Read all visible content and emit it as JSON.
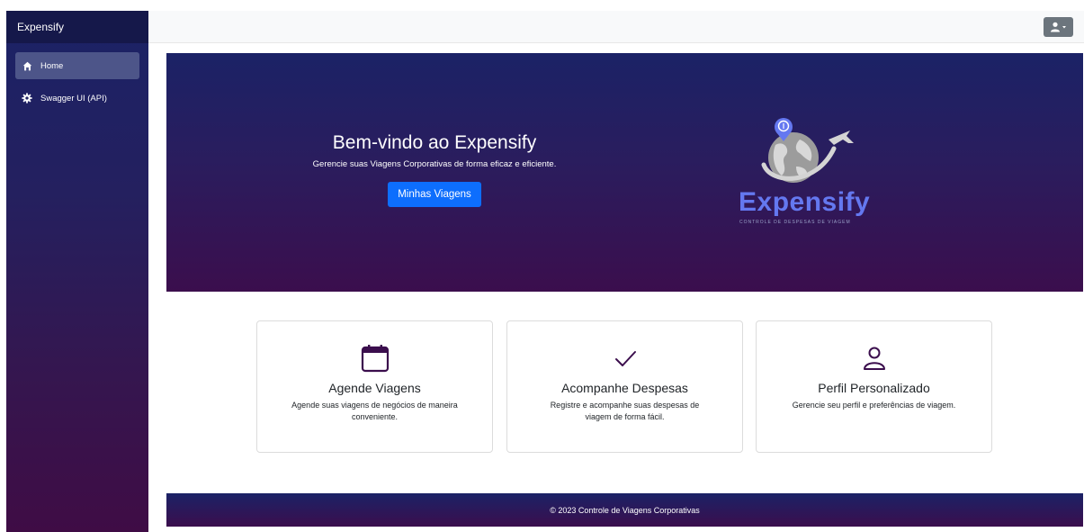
{
  "sidebar": {
    "brand": "Expensify",
    "items": [
      {
        "label": "Home",
        "icon": "home-icon",
        "active": true
      },
      {
        "label": "Swagger UI (API)",
        "icon": "gear-icon",
        "active": false
      }
    ]
  },
  "topbar": {
    "user_icon": "user-icon"
  },
  "hero": {
    "title": "Bem-vindo ao Expensify",
    "subtitle": "Gerencie suas Viagens Corporativas de forma eficaz e eficiente.",
    "button": "Minhas Viagens",
    "logo_word": "Expensify",
    "logo_tagline": "CONTROLE DE DESPESAS DE VIAGEM"
  },
  "cards": [
    {
      "icon": "calendar-icon",
      "title": "Agende Viagens",
      "text": "Agende suas viagens de negócios de maneira conveniente."
    },
    {
      "icon": "check-icon",
      "title": "Acompanhe Despesas",
      "text": "Registre e acompanhe suas despesas de viagem de forma fácil."
    },
    {
      "icon": "person-icon",
      "title": "Perfil Personalizado",
      "text": "Gerencie seu perfil e preferências de viagem."
    }
  ],
  "footer": {
    "text": "© 2023 Controle de Viagens Corporativas"
  },
  "colors": {
    "primary_button": "#0d6efd",
    "sidebar_top": "#1b2266",
    "sidebar_bottom": "#3f0c45",
    "logo": "#6478f0"
  }
}
